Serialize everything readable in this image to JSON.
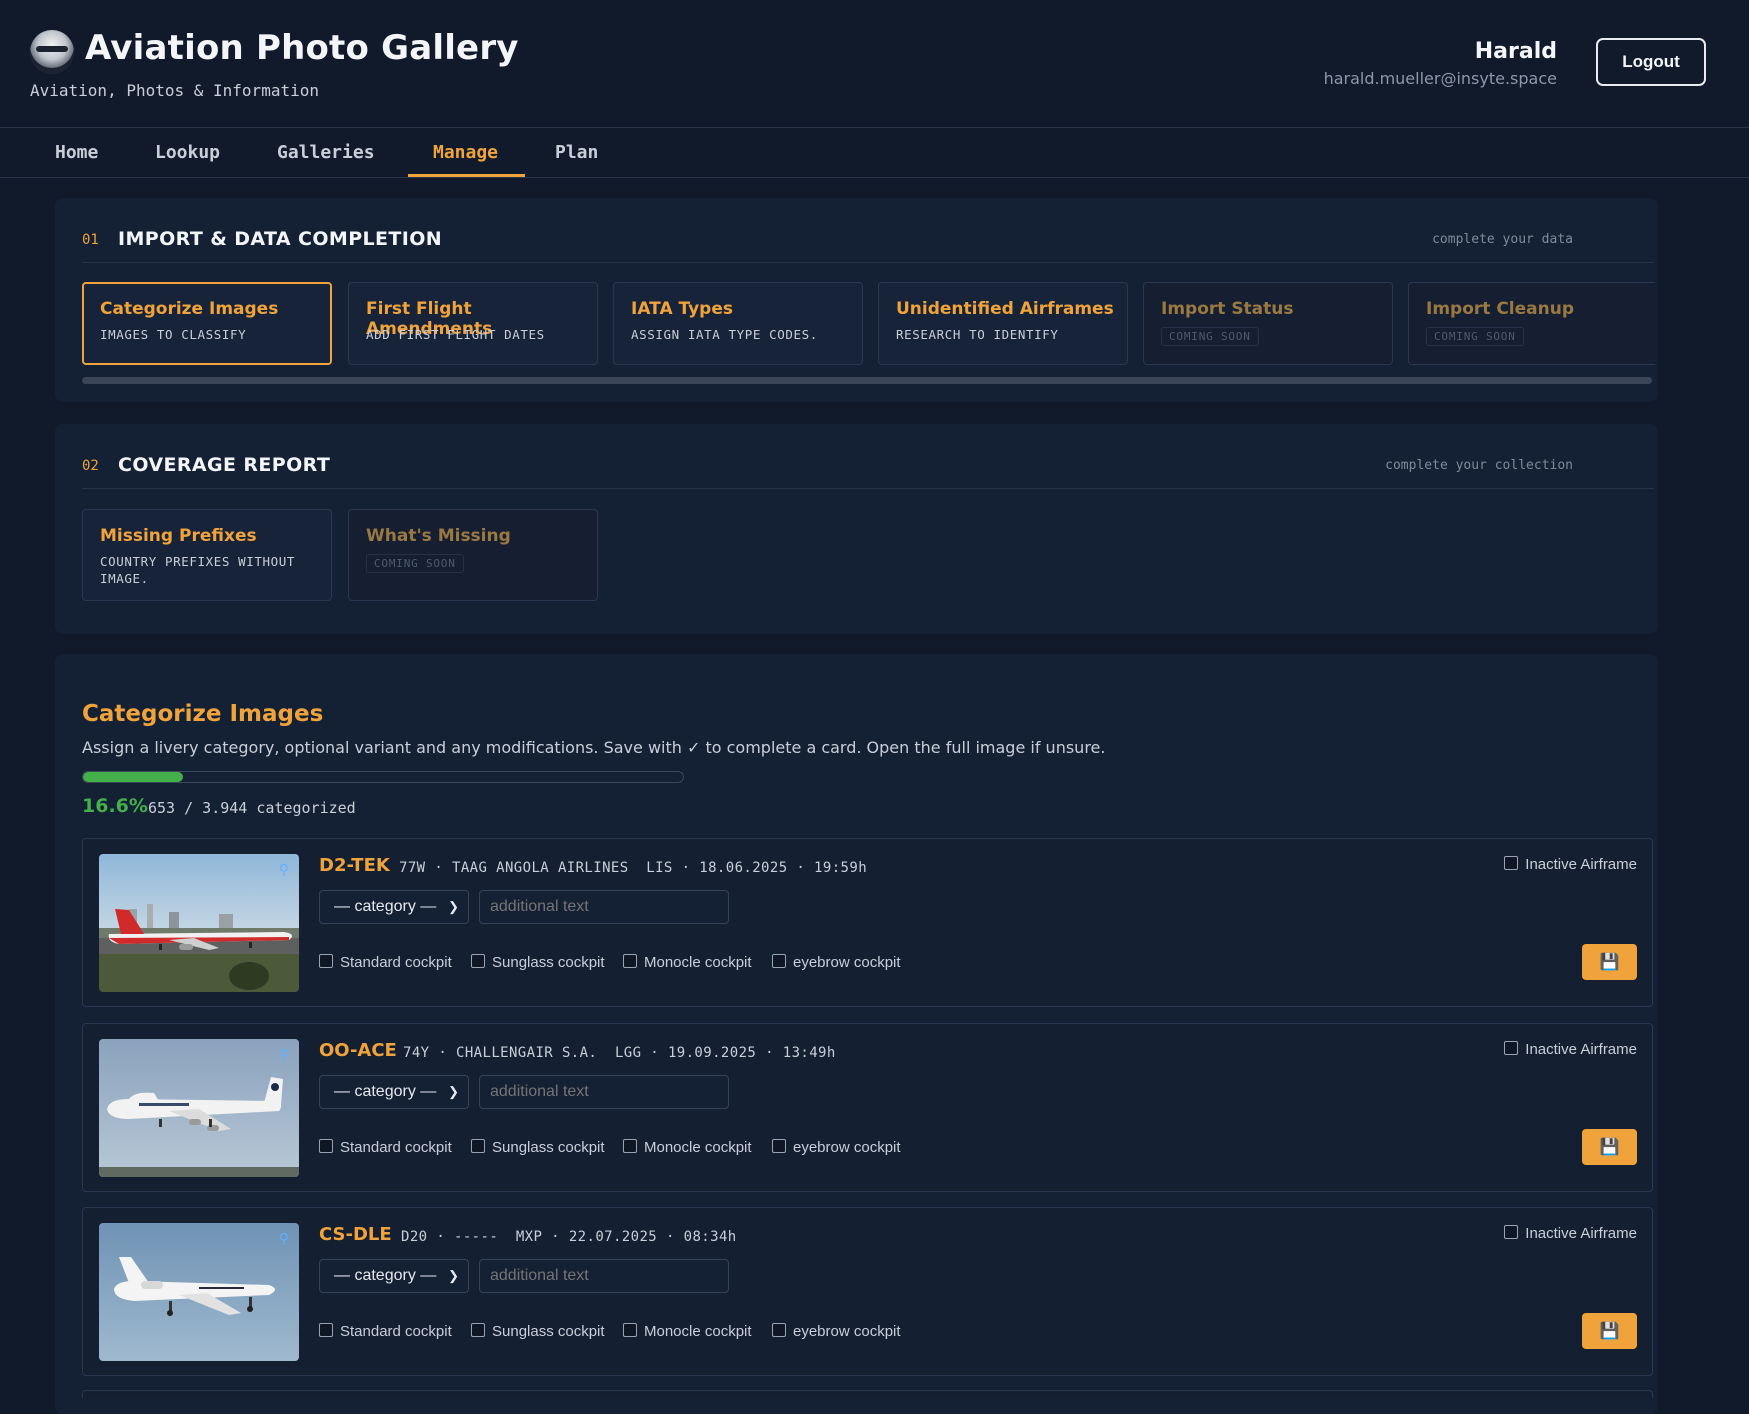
{
  "header": {
    "title": "Aviation Photo Gallery",
    "subtitle": "Aviation, Photos & Information",
    "user_name": "Harald",
    "user_email": "harald.mueller@insyte.space",
    "logout_label": "Logout"
  },
  "nav": {
    "items": [
      "Home",
      "Lookup",
      "Galleries",
      "Manage",
      "Plan"
    ],
    "active": "Manage"
  },
  "section1": {
    "number": "01",
    "title": "IMPORT & DATA COMPLETION",
    "hint": "complete your data",
    "cards": [
      {
        "title": "Categorize Images",
        "subtitle": "IMAGES TO CLASSIFY"
      },
      {
        "title": "First Flight Amendments",
        "subtitle": "ADD FIRST FLIGHT DATES"
      },
      {
        "title": "IATA Types",
        "subtitle": "ASSIGN IATA TYPE CODES."
      },
      {
        "title": "Unidentified Airframes",
        "subtitle": "RESEARCH TO IDENTIFY"
      },
      {
        "title": "Import Status",
        "badge": "COMING SOON"
      },
      {
        "title": "Import Cleanup",
        "badge": "COMING SOON"
      }
    ]
  },
  "section2": {
    "number": "02",
    "title": "COVERAGE REPORT",
    "hint": "complete your collection",
    "cards": [
      {
        "title": "Missing Prefixes",
        "subtitle": "COUNTRY PREFIXES WITHOUT IMAGE."
      },
      {
        "title": "What's Missing",
        "badge": "COMING SOON"
      }
    ]
  },
  "categorize": {
    "title": "Categorize Images",
    "description": "Assign a livery category, optional variant and any modifications. Save with ✓ to complete a card. Open the full image if unsure.",
    "progress_percent": 16.6,
    "progress_label": "16.6%",
    "count_label": "653 / 3.944 categorized",
    "category_placeholder": "— category —",
    "text_placeholder": "additional text",
    "inactive_label": "Inactive Airframe",
    "checkboxes": [
      "Standard cockpit",
      "Sunglass cockpit",
      "Monocle cockpit",
      "eyebrow cockpit"
    ],
    "items": [
      {
        "reg": "D2-TEK",
        "type": "77W",
        "airline": "TAAG ANGOLA AIRLINES",
        "airport": "LIS",
        "date": "18.06.2025",
        "time": "19:59h"
      },
      {
        "reg": "OO-ACE",
        "type": "74Y",
        "airline": "CHALLENGAIR S.A.",
        "airport": "LGG",
        "date": "19.09.2025",
        "time": "13:49h"
      },
      {
        "reg": "CS-DLE",
        "type": "D20",
        "airline": "-----",
        "airport": "MXP",
        "date": "22.07.2025",
        "time": "08:34h"
      }
    ]
  },
  "icons": {
    "zoom": "magnifier-icon",
    "save": "floppy-disk-icon",
    "select": "chevron-down-icon"
  },
  "colors": {
    "accent": "#f0a33a",
    "progress": "#43b04a",
    "background": "#111a2b"
  }
}
